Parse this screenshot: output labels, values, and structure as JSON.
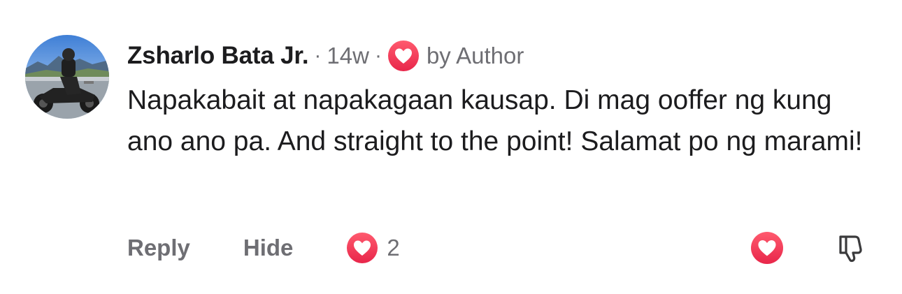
{
  "comment": {
    "author": "Zsharlo Bata Jr.",
    "separator": "·",
    "time": "14w",
    "badge_icon": "heart-icon",
    "badge_label": "by Author",
    "text": "Napakabait at napakagaan kausap. Di mag ooffer ng kung ano ano pa. And straight to the point! Salamat po ng marami!"
  },
  "actions": {
    "reply_label": "Reply",
    "hide_label": "Hide",
    "reaction_icon": "heart-icon",
    "reaction_count": "2",
    "like_icon": "heart-icon",
    "dislike_icon": "thumbs-down-icon"
  },
  "colors": {
    "heart_gradient_top": "#ff5a6e",
    "heart_gradient_bottom": "#e8264a",
    "secondary_text": "#6e6e73",
    "primary_text": "#1c1c1e"
  }
}
